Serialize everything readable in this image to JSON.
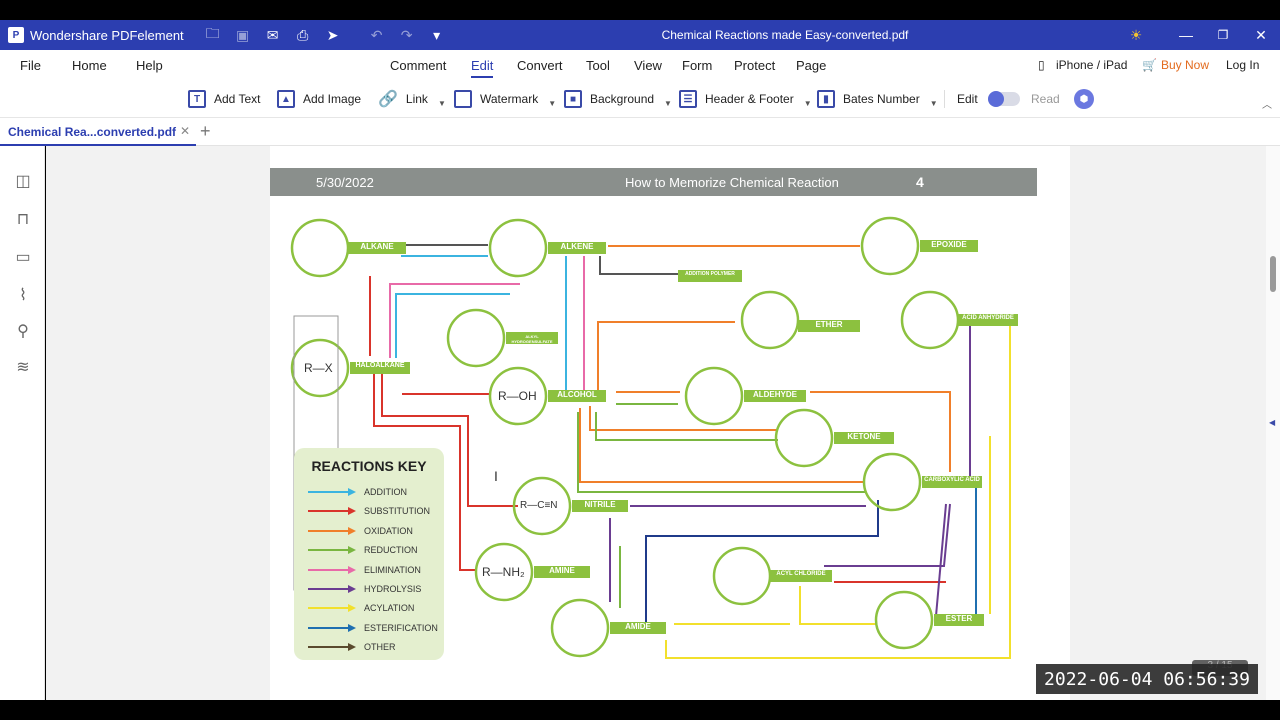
{
  "app": {
    "name": "Wondershare PDFelement",
    "doc_title": "Chemical Reactions made Easy-converted.pdf"
  },
  "menu": {
    "file": "File",
    "home": "Home",
    "help": "Help",
    "comment": "Comment",
    "edit": "Edit",
    "convert": "Convert",
    "tool": "Tool",
    "view": "View",
    "form": "Form",
    "protect": "Protect",
    "page": "Page",
    "iphone": "iPhone / iPad",
    "buy": "Buy Now",
    "login": "Log In"
  },
  "toolbar": {
    "add_text": "Add Text",
    "add_image": "Add Image",
    "link": "Link",
    "watermark": "Watermark",
    "background": "Background",
    "header_footer": "Header & Footer",
    "bates": "Bates Number",
    "edit": "Edit",
    "read": "Read"
  },
  "tab": {
    "label": "Chemical Rea...converted.pdf"
  },
  "pdf": {
    "date": "5/30/2022",
    "header": "How to Memorize Chemical Reaction",
    "page_number": "4",
    "key_title": "REACTIONS KEY",
    "key": [
      {
        "label": "ADDITION",
        "color": "#3bb4e0"
      },
      {
        "label": "SUBSTITUTION",
        "color": "#d9342b"
      },
      {
        "label": "OXIDATION",
        "color": "#f07f2a"
      },
      {
        "label": "REDUCTION",
        "color": "#7ab640"
      },
      {
        "label": "ELIMINATION",
        "color": "#e86aa8"
      },
      {
        "label": "HYDROLYSIS",
        "color": "#6a3d91"
      },
      {
        "label": "ACYLATION",
        "color": "#f2e02c"
      },
      {
        "label": "ESTERIFICATION",
        "color": "#1f6fb0"
      },
      {
        "label": "OTHER",
        "color": "#5a4a2e"
      }
    ],
    "nodes": {
      "alkane": "ALKANE",
      "alkene": "ALKENE",
      "epoxide": "EPOXIDE",
      "haloalkane": "HALOALKANE",
      "alcohol": "ALCOHOL",
      "ether": "ETHER",
      "aldehyde": "ALDEHYDE",
      "ketone": "KETONE",
      "carboxylic": "CARBOXYLIC ACID",
      "nitrile": "NITRILE",
      "amine": "AMINE",
      "amide": "AMIDE",
      "acyl": "ACYL CHLORIDE",
      "ester": "ESTER",
      "anhydride": "ACID ANHYDRIDE",
      "addition_polymer": "ADDITION POLYMER",
      "alkyl_hydrogensulfate": "ALKYL HYDROGENSULFATE"
    },
    "formulas": {
      "rx": "R—X",
      "roh": "R—OH",
      "rcn": "R—C≡N",
      "rnh2": "R—NH₂"
    }
  },
  "status": {
    "timestamp": "2022-06-04 06:56:39",
    "page_count": "3 / 15"
  },
  "colors": {
    "titlebar": "#2c3eb0",
    "accent": "#2c3eb0",
    "buy": "#e36b1e",
    "node_green": "#8cc13f"
  }
}
